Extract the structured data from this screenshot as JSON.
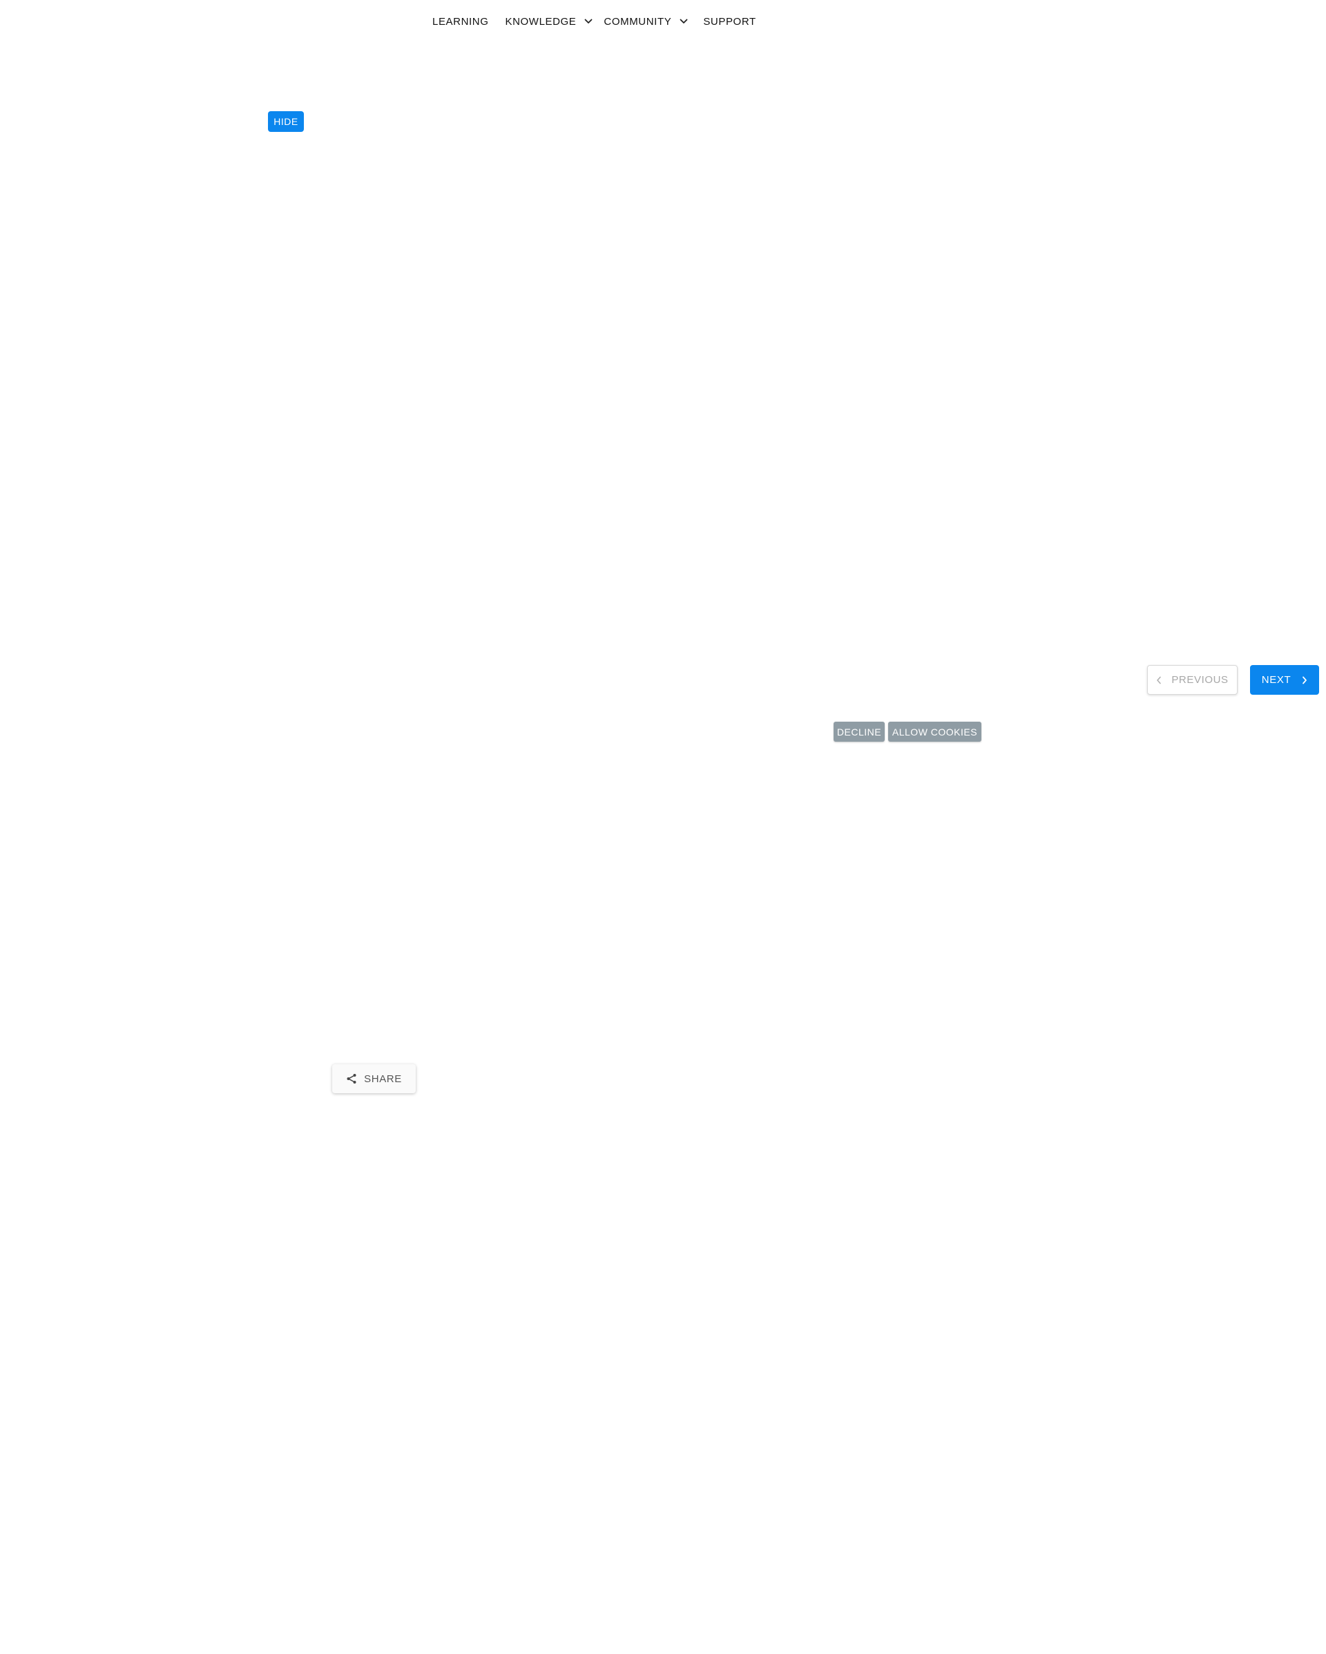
{
  "nav": {
    "items": [
      {
        "label": "LEARNING",
        "has_dropdown": false
      },
      {
        "label": "KNOWLEDGE",
        "has_dropdown": true
      },
      {
        "label": "COMMUNITY",
        "has_dropdown": true
      },
      {
        "label": "SUPPORT",
        "has_dropdown": false
      }
    ]
  },
  "sidebar": {
    "hide_label": "HIDE"
  },
  "pagination": {
    "previous_label": "PREVIOUS",
    "previous_enabled": false,
    "next_label": "NEXT"
  },
  "cookie_banner": {
    "decline_label": "DECLINE",
    "allow_label": "ALLOW COOKIES"
  },
  "share": {
    "label": "SHARE",
    "icon": "share-icon"
  },
  "colors": {
    "accent": "#0b86ee",
    "cookie_button": "#8f9ca4",
    "disabled_text": "#a8a8a8"
  }
}
